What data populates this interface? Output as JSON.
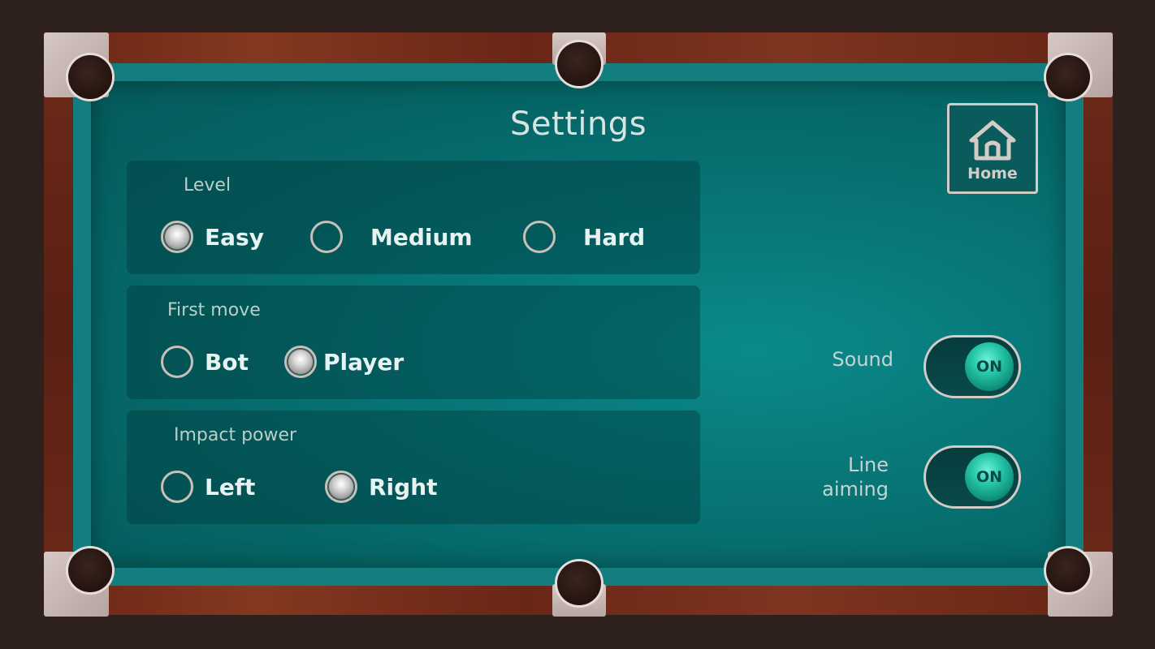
{
  "screen": {
    "title": "Settings",
    "colors": {
      "felt": "#08797a",
      "cushion": "#127e80",
      "rail": "#6e2a1a",
      "background": "#2e201c",
      "accent_on": "#26c7a9",
      "text": "#e8f2f0"
    }
  },
  "home_button": {
    "icon": "home-icon",
    "label": "Home"
  },
  "level": {
    "label": "Level",
    "selected": "Easy",
    "options": [
      {
        "label": "Easy",
        "checked": true
      },
      {
        "label": "Medium",
        "checked": false
      },
      {
        "label": "Hard",
        "checked": false
      }
    ]
  },
  "first_move": {
    "label": "First move",
    "selected": "Player",
    "options": [
      {
        "label": "Bot",
        "checked": false
      },
      {
        "label": "Player",
        "checked": true
      }
    ]
  },
  "impact_power": {
    "label": "Impact power",
    "selected": "Right",
    "options": [
      {
        "label": "Left",
        "checked": false
      },
      {
        "label": "Right",
        "checked": true
      }
    ]
  },
  "toggles": {
    "sound": {
      "label": "Sound",
      "state": "ON"
    },
    "line_aiming": {
      "label_line1": "Line",
      "label_line2": "aiming",
      "state": "ON"
    }
  }
}
